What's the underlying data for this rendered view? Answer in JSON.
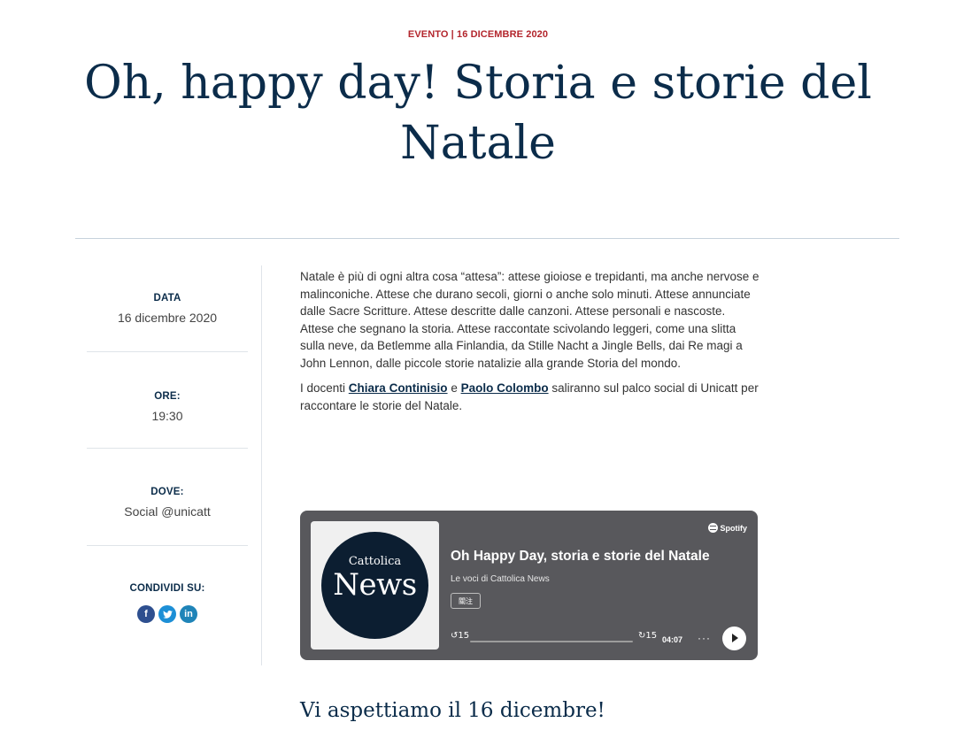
{
  "header": {
    "eyebrow": "EVENTO | 16 DICEMBRE 2020",
    "title": "Oh, happy day! Storia e storie del Natale"
  },
  "sidebar": {
    "data": {
      "label": "DATA",
      "value": "16 dicembre 2020"
    },
    "ore": {
      "label": "ORE:",
      "value": "19:30"
    },
    "dove": {
      "label": "DOVE:",
      "value": "Social @unicatt"
    },
    "share": {
      "label": "CONDIVIDI SU:",
      "icons": [
        "facebook-icon",
        "twitter-icon",
        "linkedin-icon"
      ]
    }
  },
  "content": {
    "paragraph1": "Natale è più di ogni altra cosa “attesa”: attese gioiose e trepidanti, ma anche nervose e malinconiche. Attese che durano secoli, giorni o anche solo minuti. Attese annunciate dalle Sacre Scritture. Attese descritte dalle canzoni. Attese personali e nascoste. Attese che segnano la storia. Attese raccontate scivolando leggeri, come una slitta sulla neve, da Betlemme alla Finlandia, da Stille Nacht a Jingle Bells, dai Re magi a John Lennon, dalle piccole storie natalizie alla grande Storia del mondo.",
    "p2_pre": "I docenti ",
    "link1": "Chiara Continisio",
    "p2_mid": " e ",
    "link2": "Paolo Colombo",
    "p2_post": " saliranno sul palco social di Unicatt per raccontare le storie del Natale."
  },
  "player": {
    "brand": "Spotify",
    "cover_top": "Cattolica",
    "cover_main": "News",
    "episode_title": "Oh Happy Day, storia e storie del Natale",
    "show_name": "Le voci di Cattolica News",
    "follow_label": "關注",
    "skip_back": "15",
    "skip_forward": "15",
    "time": "04:07",
    "more": "···",
    "progress": 0
  },
  "closing": "Vi aspettiamo il 16 dicembre!",
  "colors": {
    "accent": "#b3262d",
    "navy": "#0b2c4a",
    "player_bg": "#58585c"
  }
}
